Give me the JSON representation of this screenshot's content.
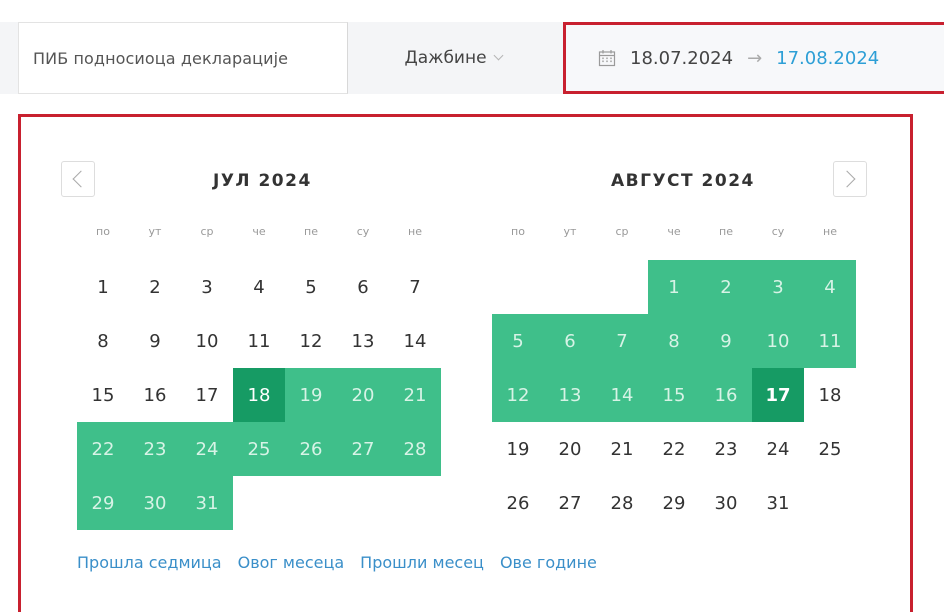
{
  "filters": {
    "pib_placeholder": "ПИБ подносиоца декларације",
    "taxes_label": "Дажбине",
    "date_start": "18.07.2024",
    "date_arrow": "→",
    "date_end": "17.08.2024"
  },
  "colors": {
    "accent": "#c8202f",
    "range_fill": "#3fbf8a",
    "range_edge": "#169b64",
    "link": "#3a8fc9",
    "end_date_text": "#2d9fd6"
  },
  "icons": {
    "calendar": "calendar-icon",
    "taxes_chevron": "chevron-down-icon",
    "prev": "chevron-left-icon",
    "next": "chevron-right-icon",
    "range_arrow": "arrow-right-icon"
  },
  "weekdays": [
    "по",
    "ут",
    "ср",
    "че",
    "пе",
    "су",
    "не"
  ],
  "calendar": {
    "left": {
      "title": "ЈУЛ 2024",
      "weeks": [
        [
          "1",
          "2",
          "3",
          "4",
          "5",
          "6",
          "7"
        ],
        [
          "8",
          "9",
          "10",
          "11",
          "12",
          "13",
          "14"
        ],
        [
          "15",
          "16",
          "17",
          "18",
          "19",
          "20",
          "21"
        ],
        [
          "22",
          "23",
          "24",
          "25",
          "26",
          "27",
          "28"
        ],
        [
          "29",
          "30",
          "31",
          "",
          "",
          "",
          ""
        ]
      ],
      "range_start_day": 18
    },
    "right": {
      "title": "АВГУСТ 2024",
      "weeks": [
        [
          "",
          "",
          "",
          "1",
          "2",
          "3",
          "4"
        ],
        [
          "5",
          "6",
          "7",
          "8",
          "9",
          "10",
          "11"
        ],
        [
          "12",
          "13",
          "14",
          "15",
          "16",
          "17",
          "18"
        ],
        [
          "19",
          "20",
          "21",
          "22",
          "23",
          "24",
          "25"
        ],
        [
          "26",
          "27",
          "28",
          "29",
          "30",
          "31",
          ""
        ]
      ],
      "range_end_day": 17
    }
  },
  "presets": [
    "Прошла седмица",
    "Овог месеца",
    "Прошли месец",
    "Ове године"
  ]
}
